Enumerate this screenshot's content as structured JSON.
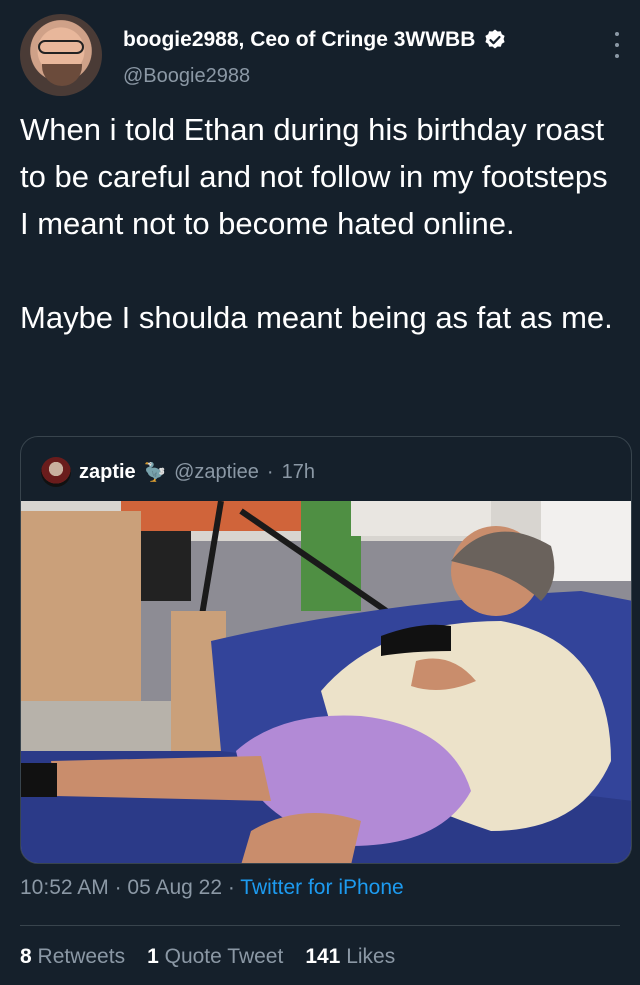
{
  "tweet": {
    "display_name": "boogie2988, Ceo of Cringe 3WWBB",
    "handle": "@Boogie2988",
    "paragraphs": [
      "When i told Ethan during his birthday roast to be careful and not follow in my footsteps I meant not to become hated online.",
      "Maybe I shoulda meant being as fat as me."
    ]
  },
  "quoted": {
    "name": "zaptie",
    "emoji": "🦤",
    "handle": "@zaptiee",
    "separator": "·",
    "time": "17h"
  },
  "meta": {
    "time": "10:52 AM",
    "sep1": " · ",
    "date": "05 Aug 22",
    "sep2": " · ",
    "source": "Twitter for iPhone"
  },
  "stats": {
    "retweets_count": "8",
    "retweets_label": "Retweets",
    "quotes_count": "1",
    "quotes_label": "Quote Tweet",
    "likes_count": "141",
    "likes_label": "Likes"
  },
  "colors": {
    "background": "#15202b",
    "muted": "#8b98a5",
    "accent": "#1d9bf0",
    "border": "#38444d"
  },
  "icons": [
    "verified-badge-icon",
    "more-options-icon"
  ]
}
